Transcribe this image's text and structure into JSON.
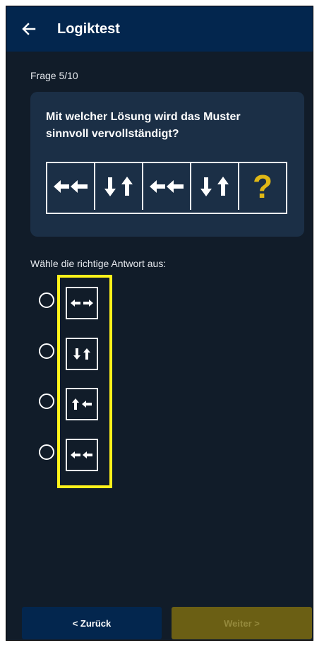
{
  "appbar": {
    "title": "Logiktest",
    "back_icon": "arrow-left-icon"
  },
  "progress": "Frage 5/10",
  "question": {
    "text": "Mit welcher Lösung wird das Muster sinnvoll vervollständigt?",
    "sequence": [
      "left-left",
      "down-up",
      "left-left",
      "down-up",
      "?"
    ],
    "missing_label": "?"
  },
  "prompt": "Wähle die richtige Antwort aus:",
  "options": [
    {
      "id": "A",
      "pattern": "left-right"
    },
    {
      "id": "B",
      "pattern": "down-up"
    },
    {
      "id": "C",
      "pattern": "up-left"
    },
    {
      "id": "D",
      "pattern": "left-left"
    }
  ],
  "buttons": {
    "back": "< Zurück",
    "next": "Weiter >"
  },
  "colors": {
    "appbar": "#03264e",
    "background": "#111c29",
    "card": "#1b2f46",
    "question_mark": "#e0b816",
    "highlight": "#fff21a",
    "next_disabled": "#6b5f14"
  }
}
